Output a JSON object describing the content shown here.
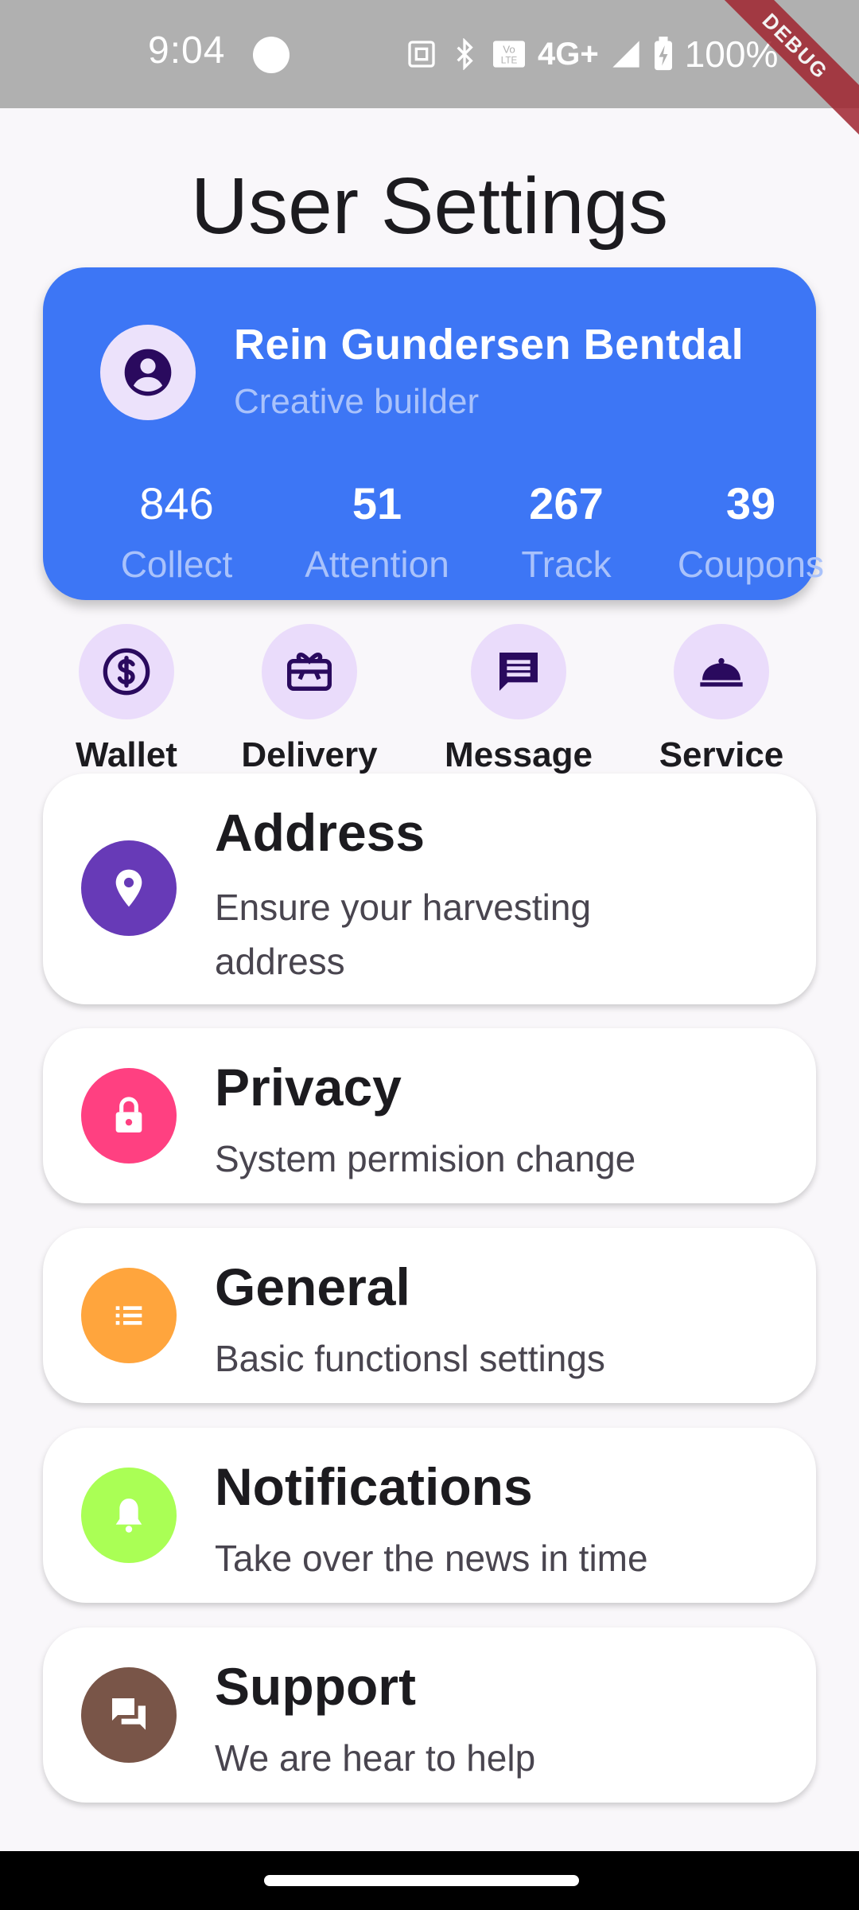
{
  "status_bar": {
    "time": "9:04",
    "network": "4G+",
    "battery": "100%",
    "debug_banner": "DEBUG"
  },
  "page": {
    "title": "User Settings"
  },
  "profile": {
    "name": "Rein Gundersen Bentdal",
    "subtitle": "Creative builder",
    "stats": [
      {
        "value": "846",
        "label": "Collect"
      },
      {
        "value": "51",
        "label": "Attention"
      },
      {
        "value": "267",
        "label": "Track"
      },
      {
        "value": "39",
        "label": "Coupons"
      }
    ]
  },
  "quick_actions": [
    {
      "label": "Wallet",
      "icon": "dollar-circle-icon"
    },
    {
      "label": "Delivery",
      "icon": "gift-card-icon"
    },
    {
      "label": "Message",
      "icon": "message-icon"
    },
    {
      "label": "Service",
      "icon": "room-service-icon"
    }
  ],
  "settings": [
    {
      "title": "Address",
      "description": "Ensure your harvesting address",
      "icon": "location-pin-icon",
      "color": "#673ab7"
    },
    {
      "title": "Privacy",
      "description": "System permision change",
      "icon": "lock-icon",
      "color": "#ff4081"
    },
    {
      "title": "General",
      "description": "Basic functionsl settings",
      "icon": "list-icon",
      "color": "#ffa53d"
    },
    {
      "title": "Notifications",
      "description": "Take over the news in time",
      "icon": "bell-icon",
      "color": "#aaff55"
    },
    {
      "title": "Support",
      "description": "We are hear to help",
      "icon": "forum-icon",
      "color": "#795548"
    }
  ],
  "colors": {
    "card_blue": "#3d76f5",
    "quick_icon_bg": "#eadcfb",
    "quick_icon_fg": "#2a0a5e"
  }
}
